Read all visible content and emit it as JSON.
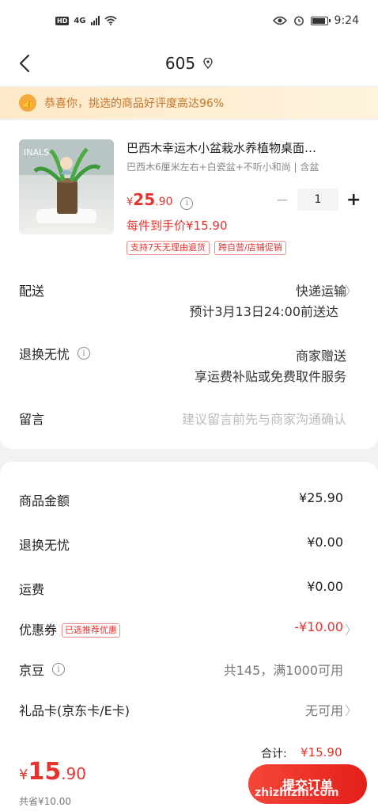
{
  "status_bar": {
    "hd": "HD",
    "net": "4G",
    "time": "9:24"
  },
  "nav": {
    "title": "605"
  },
  "banner": {
    "text": "恭喜你，挑选的商品好评度高达96%"
  },
  "product": {
    "title": "巴西木幸运木小盆栽水养植物桌面…",
    "spec": "巴西木6厘米左右+白瓷盆+不听小和尚 | 含盆",
    "price_yen": "¥",
    "price_int": "25",
    "price_dec": ".90",
    "quantity": "1",
    "minus": "−",
    "plus": "+",
    "per_price": "每件到手价¥15.90",
    "tags": [
      "支持7天无理由退货",
      "跨自营/店铺促销"
    ]
  },
  "delivery": {
    "label": "配送",
    "method": "快递运输",
    "eta": "预计3月13日24:00前送达"
  },
  "return_service": {
    "label": "退换无忧",
    "value": "商家赠送",
    "desc": "享运费补贴或免费取件服务"
  },
  "remark": {
    "label": "留言",
    "placeholder": "建议留言前先与商家沟通确认"
  },
  "summary": {
    "goods_label": "商品金额",
    "goods_value": "¥25.90",
    "return_label": "退换无忧",
    "return_value": "¥0.00",
    "shipping_label": "运费",
    "shipping_value": "¥0.00",
    "coupon_label": "优惠券",
    "coupon_tag": "已选推荐优惠",
    "coupon_value": "-¥10.00",
    "beans_label": "京豆",
    "beans_value": "共145，满1000可用",
    "giftcard_label": "礼品卡(京东卡/E卡)",
    "giftcard_value": "无可用"
  },
  "bottom": {
    "total_label": "合计:",
    "total_amount": "¥15.90",
    "yen": "¥",
    "big": "15",
    "small": ".90",
    "saved": "共省¥10.00",
    "submit": "提交订单",
    "watermark": "zhizhizhi.com"
  },
  "colors": {
    "accent": "#e3342f",
    "banner_text": "#c8752a",
    "banner_bg": "#fde9c8"
  }
}
